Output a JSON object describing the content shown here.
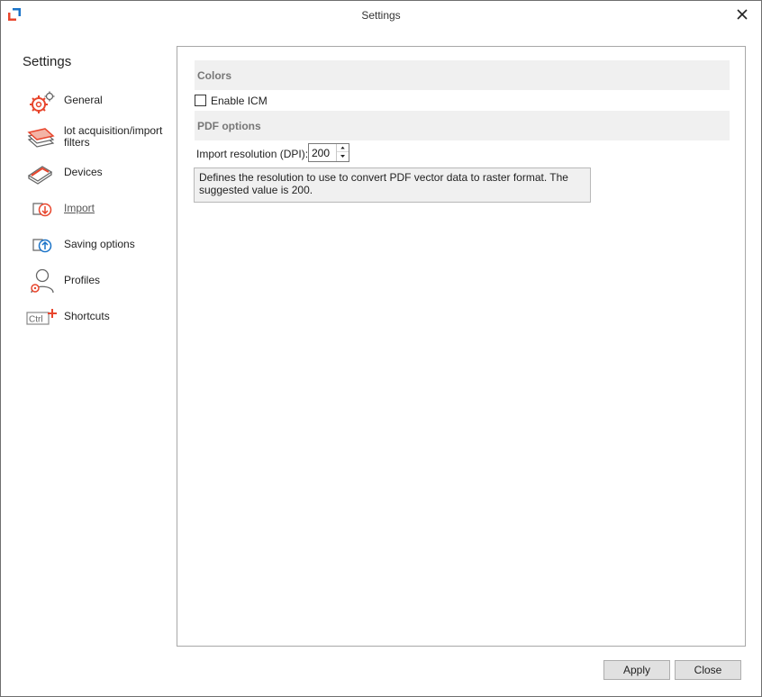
{
  "window": {
    "title": "Settings"
  },
  "sidebar": {
    "title": "Settings",
    "items": [
      {
        "label": "General",
        "icon": "gear-icon"
      },
      {
        "label": "lot acquisition/import filters",
        "icon": "stacked-pages-icon"
      },
      {
        "label": "Devices",
        "icon": "scanner-icon"
      },
      {
        "label": "Import",
        "icon": "import-icon"
      },
      {
        "label": "Saving options",
        "icon": "export-icon"
      },
      {
        "label": "Profiles",
        "icon": "user-gear-icon"
      },
      {
        "label": "Shortcuts",
        "icon": "ctrl-plus-icon"
      }
    ]
  },
  "main": {
    "colors_section": "Colors",
    "enable_icm_label": "Enable ICM",
    "enable_icm_checked": false,
    "pdf_section": "PDF options",
    "resolution_label": "Import resolution (DPI):",
    "resolution_value": "200",
    "help_text": "Defines the resolution to use to convert PDF vector data to raster format. The suggested value is 200."
  },
  "footer": {
    "apply_label": "Apply",
    "close_label": "Close"
  },
  "colors": {
    "accent": "#e8452c",
    "blue_accent": "#1a73c8",
    "section_bg": "#f0f0f0"
  }
}
